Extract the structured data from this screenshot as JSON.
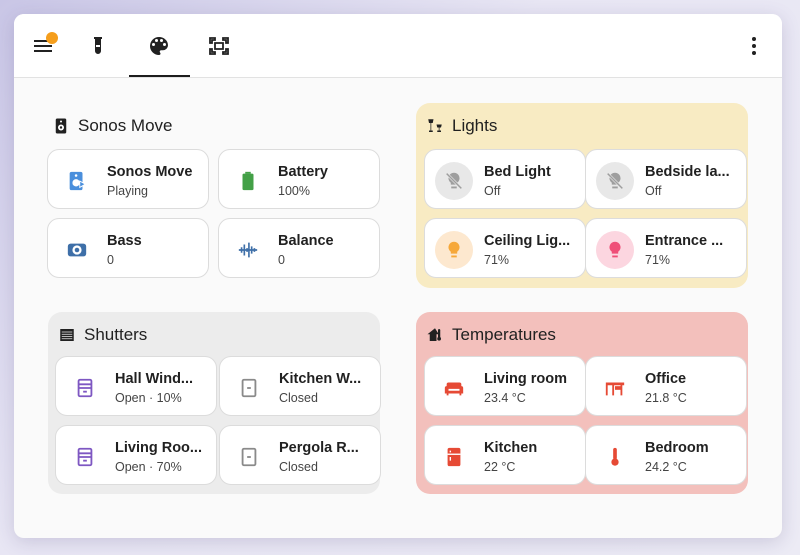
{
  "colors": {
    "accent_dot": "#f59e1c",
    "lights_bg": "#f8ebc3",
    "shutters_bg": "#ececec",
    "temps_bg": "#f3c0bc",
    "media_blue": "#4a8fdc",
    "battery_green": "#43a047",
    "shutter_purple": "#7e57c2",
    "temp_red": "#e64a35",
    "light_orange": "#f6a83a",
    "light_pink": "#ef4f78"
  },
  "toolbar": {
    "icons": [
      "menu-icon",
      "flask-icon",
      "palette-icon",
      "scan-icon",
      "more-vert-icon"
    ]
  },
  "sections": {
    "sonos": {
      "title": "Sonos Move",
      "cards": [
        {
          "name": "Sonos Move",
          "state": "Playing",
          "icon": "speaker-play-icon"
        },
        {
          "name": "Battery",
          "state": "100%",
          "icon": "battery-icon"
        },
        {
          "name": "Bass",
          "state": "0",
          "icon": "bass-icon"
        },
        {
          "name": "Balance",
          "state": "0",
          "icon": "waveform-icon"
        }
      ]
    },
    "lights": {
      "title": "Lights",
      "cards": [
        {
          "name": "Bed Light",
          "state": "Off",
          "icon": "lightbulb-off-icon"
        },
        {
          "name": "Bedside la...",
          "state": "Off",
          "icon": "lightbulb-off-icon"
        },
        {
          "name": "Ceiling Lig...",
          "state": "71%",
          "icon": "lightbulb-icon"
        },
        {
          "name": "Entrance ...",
          "state": "71%",
          "icon": "lightbulb-icon"
        }
      ]
    },
    "shutters": {
      "title": "Shutters",
      "cards": [
        {
          "name": "Hall Wind...",
          "state": "Open · 10%",
          "icon": "window-shutter-open-icon"
        },
        {
          "name": "Kitchen W...",
          "state": "Closed",
          "icon": "window-shutter-closed-icon"
        },
        {
          "name": "Living Roo...",
          "state": "Open · 70%",
          "icon": "window-shutter-open-icon"
        },
        {
          "name": "Pergola R...",
          "state": "Closed",
          "icon": "window-shutter-closed-icon"
        }
      ]
    },
    "temps": {
      "title": "Temperatures",
      "cards": [
        {
          "name": "Living room",
          "state": "23.4 °C",
          "icon": "sofa-icon"
        },
        {
          "name": "Office",
          "state": "21.8 °C",
          "icon": "desk-icon"
        },
        {
          "name": "Kitchen",
          "state": "22 °C",
          "icon": "fridge-icon"
        },
        {
          "name": "Bedroom",
          "state": "24.2 °C",
          "icon": "thermometer-icon"
        }
      ]
    }
  }
}
